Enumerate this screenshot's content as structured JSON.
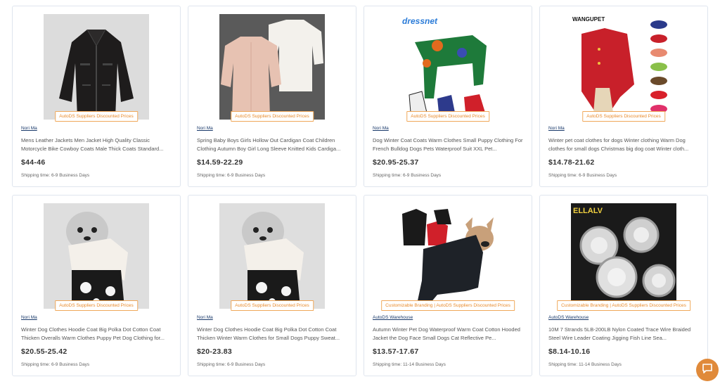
{
  "products": [
    {
      "supplier": "Nori Ma",
      "title": "Mens Leather Jackets Men Jacket High Quality Classic Motorcycle Bike Cowboy Coats Male Thick Coats Standard...",
      "price": "$44-46",
      "badge": "AutoDS Suppliers Discounted Prices",
      "shipping": "Shipping time: 6-9 Business Days",
      "image": "leather-jacket"
    },
    {
      "supplier": "Nori Ma",
      "title": "Spring Baby Boys Girls Hollow Out Cardigan Coat Children Clothing Autumn Boy Girl Long Sleeve Knitted Kids Cardiga...",
      "price": "$14.59-22.29",
      "badge": "AutoDS Suppliers Discounted Prices",
      "shipping": "Shipping time: 6-9 Business Days",
      "image": "knit-cardigans"
    },
    {
      "supplier": "Nori Ma",
      "title": "Dog Winter Coat Coats Warm Clothes Small Puppy Clothing For French Bulldog Dogs Pets Waterproof Suit XXL Pet...",
      "price": "$20.95-25.37",
      "badge": "AutoDS Suppliers Discounted Prices",
      "shipping": "Shipping time: 6-9 Business Days",
      "image": "dog-camo-suit",
      "image_text": "dressnet"
    },
    {
      "supplier": "Nori Ma",
      "title": "Winter pet coat clothes for dogs Winter clothing Warm Dog clothes for small dogs Christmas big dog coat Winter cloth...",
      "price": "$14.78-21.62",
      "badge": "AutoDS Suppliers Discounted Prices",
      "shipping": "Shipping time: 6-9 Business Days",
      "image": "dog-red-vest",
      "image_text": "WANGUPET"
    },
    {
      "supplier": "Nori Ma",
      "title": "Winter Dog Clothes Hoodie Coat Big Polka Dot Cotton Coat Thicken Overalls Warm Clothes Puppy Pet Dog Clothing for...",
      "price": "$20.55-25.42",
      "badge": "AutoDS Suppliers Discounted Prices",
      "shipping": "Shipping time: 6-9 Business Days",
      "image": "dog-polka-hoodie"
    },
    {
      "supplier": "Nori Ma",
      "title": "Winter Dog Clothes Hoodie Coat Big Polka Dot Cotton Coat Thicken Winter Warm Clothes for Small Dogs Puppy Sweat...",
      "price": "$20-23.83",
      "badge": "AutoDS Suppliers Discounted Prices",
      "shipping": "Shipping time: 6-9 Business Days",
      "image": "dog-polka-hoodie"
    },
    {
      "supplier": "AutoDS Warehouse",
      "title": "Autumn Winter Pet Dog Waterproof Warm Coat Cotton Hooded Jacket the Dog Face Small Dogs Cat Reflective Pe...",
      "price": "$13.57-17.67",
      "badge": "Customizable Branding | AutoDS Suppliers Discounted Prices",
      "shipping": "Shipping time: 11-14 Business Days",
      "image": "bulldog-black-jacket"
    },
    {
      "supplier": "AutoDS Warehouse",
      "title": "10M 7 Strands 5LB-200LB Nylon Coated Trace Wire Braided Steel Wire Leader Coating Jigging Fish Line Sea...",
      "price": "$8.14-10.16",
      "badge": "Customizable Branding | AutoDS Suppliers Discounted Prices",
      "shipping": "Shipping time: 11-14 Business Days",
      "image": "wire-spools",
      "image_text": "ELLALV"
    }
  ],
  "chat": {
    "icon": "chat-icon",
    "color": "#e08a3a"
  }
}
